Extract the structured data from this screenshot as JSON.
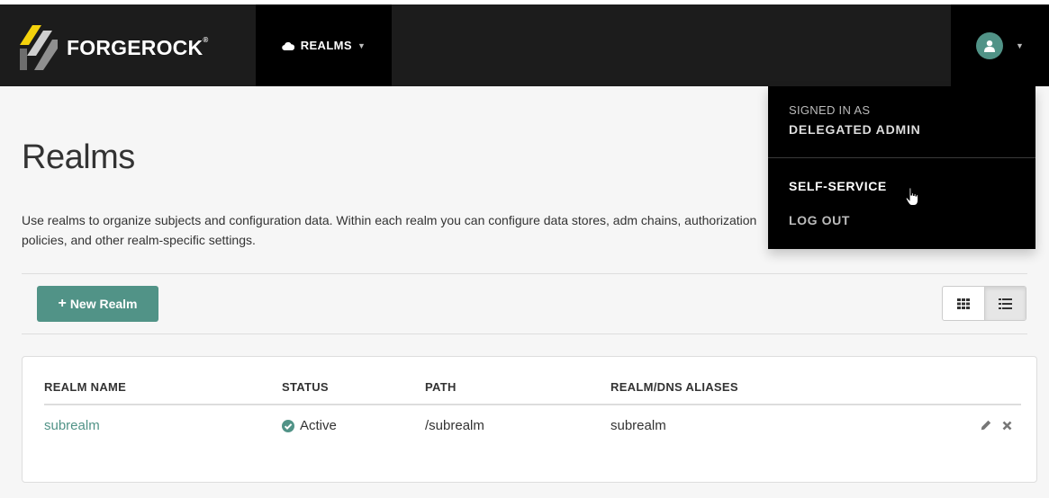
{
  "navbar": {
    "brand": "FORGEROCK",
    "brand_mark": "®",
    "realms_label": "REALMS"
  },
  "user_menu": {
    "signed_in_label": "SIGNED IN AS",
    "user_name": "DELEGATED ADMIN",
    "items": [
      {
        "label": "SELF-SERVICE",
        "state": "hover"
      },
      {
        "label": "LOG OUT"
      }
    ]
  },
  "page": {
    "title": "Realms",
    "description": "Use realms to organize subjects and configuration data. Within each realm you can configure data stores, adm chains, authorization policies, and other realm-specific settings.",
    "new_realm_label": "New Realm",
    "view_mode": "list"
  },
  "table": {
    "columns": [
      "REALM NAME",
      "STATUS",
      "PATH",
      "REALM/DNS ALIASES"
    ],
    "rows": [
      {
        "name": "subrealm",
        "status": "Active",
        "path": "/subrealm",
        "aliases": "subrealm"
      }
    ]
  },
  "colors": {
    "accent": "#519387",
    "navbar": "#1c1c1c",
    "navbar_active": "#000000",
    "logo_yellow": "#f4d20c"
  },
  "icons": {
    "brand": "forgerock-logo-icon",
    "realms": "cloud-icon",
    "avatar": "user-icon",
    "add": "plus-icon",
    "grid_view": "grid-icon",
    "list_view": "list-icon",
    "status": "check-circle-icon",
    "edit": "pencil-icon",
    "delete": "close-icon",
    "cursor": "hand-pointer-icon"
  }
}
